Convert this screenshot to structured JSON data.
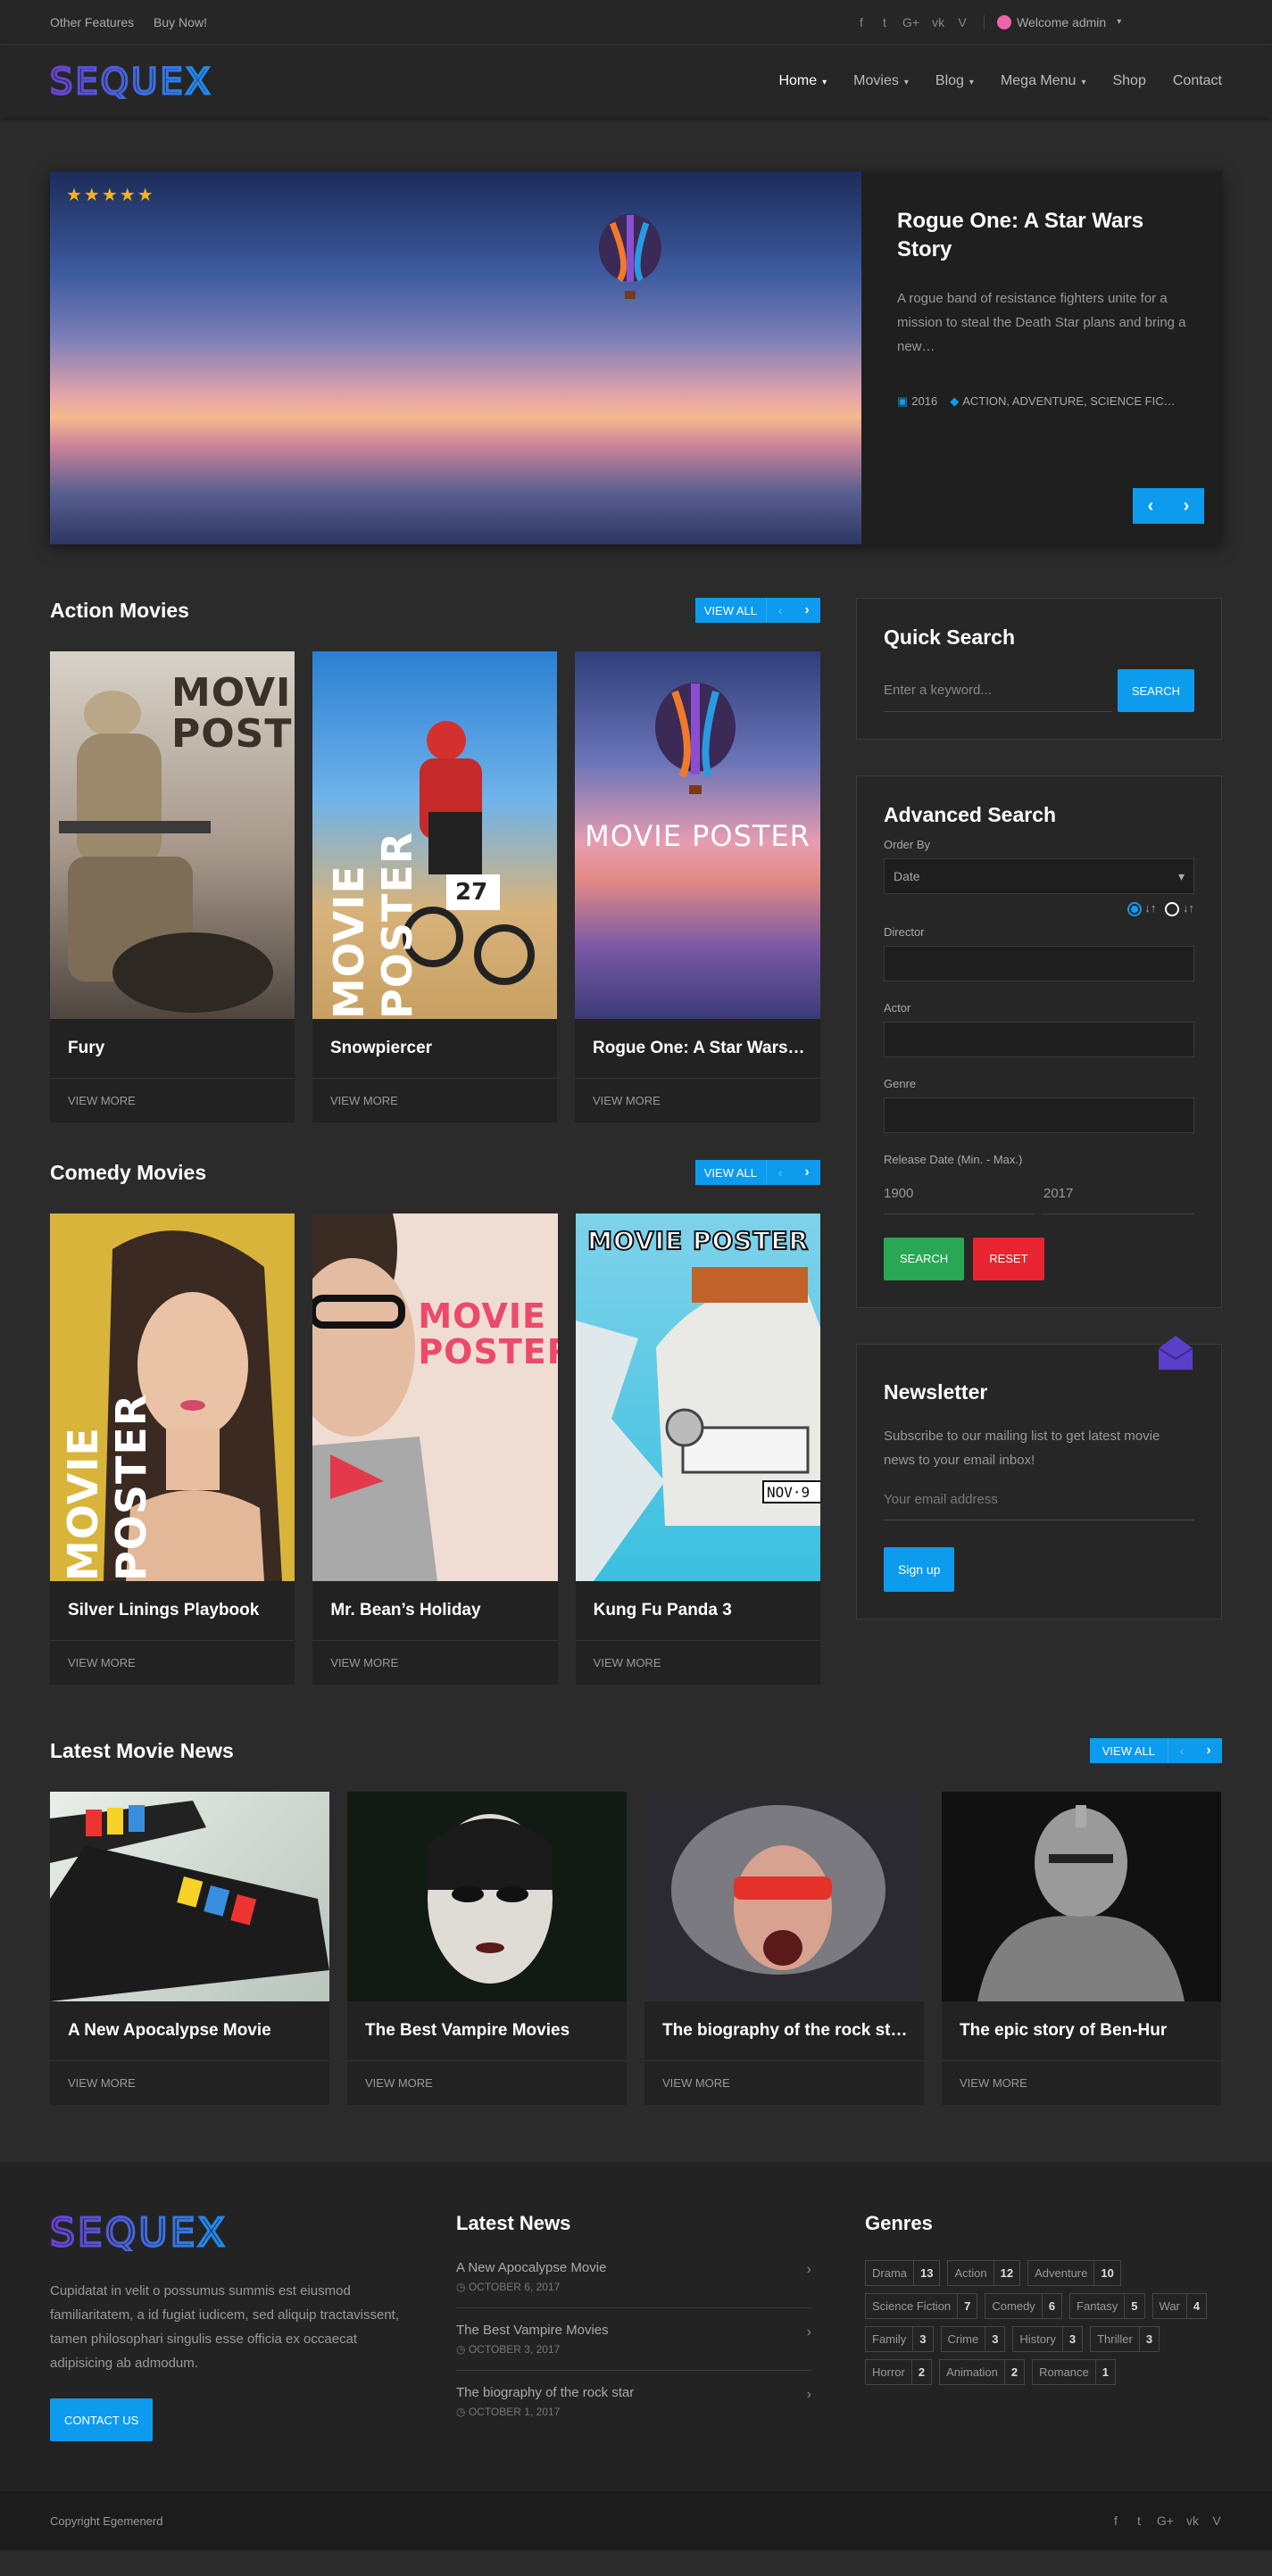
{
  "topbar": {
    "links": [
      "Other Features",
      "Buy Now!"
    ],
    "social": [
      "f",
      "t",
      "G+",
      "vk",
      "V"
    ],
    "welcome": "Welcome admin"
  },
  "nav": {
    "items": [
      {
        "label": "Home",
        "dropdown": true,
        "active": true
      },
      {
        "label": "Movies",
        "dropdown": true
      },
      {
        "label": "Blog",
        "dropdown": true
      },
      {
        "label": "Mega Menu",
        "dropdown": true
      },
      {
        "label": "Shop",
        "dropdown": false
      },
      {
        "label": "Contact",
        "dropdown": false
      }
    ]
  },
  "hero": {
    "rating": "★★★★★",
    "title": "Rogue One: A Star Wars Story",
    "description": "A rogue band of resistance fighters unite for a mission to steal the Death Star plans and bring a new…",
    "year": "2016",
    "genres": "ACTION, ADVENTURE, SCIENCE FIC…"
  },
  "action": {
    "title": "Action Movies",
    "view_all": "VIEW ALL",
    "movies": [
      {
        "title": "Fury",
        "more": "VIEW MORE",
        "poster_text": "MOVIE POSTER"
      },
      {
        "title": "Snowpiercer",
        "more": "VIEW MORE",
        "poster_text": "MOVIE POSTER"
      },
      {
        "title": "Rogue One: A Star Wars…",
        "more": "VIEW MORE",
        "poster_text": "MOVIE POSTER"
      }
    ]
  },
  "comedy": {
    "title": "Comedy Movies",
    "view_all": "VIEW ALL",
    "movies": [
      {
        "title": "Silver Linings Playbook",
        "more": "VIEW MORE",
        "poster_text": "MOVIE POSTER"
      },
      {
        "title": "Mr. Bean’s Holiday",
        "more": "VIEW MORE",
        "poster_text": "MOVIE POSTER"
      },
      {
        "title": "Kung Fu Panda 3",
        "more": "VIEW MORE",
        "poster_text": "MOVIE POSTER"
      }
    ]
  },
  "quick_search": {
    "title": "Quick Search",
    "placeholder": "Enter a keyword...",
    "button": "SEARCH"
  },
  "advanced_search": {
    "title": "Advanced Search",
    "order_by_label": "Order By",
    "order_by_value": "Date",
    "director_label": "Director",
    "actor_label": "Actor",
    "genre_label": "Genre",
    "release_label": "Release Date (Min. - Max.)",
    "date_min": "1900",
    "date_max": "2017",
    "search_button": "SEARCH",
    "reset_button": "RESET"
  },
  "newsletter": {
    "title": "Newsletter",
    "description": "Subscribe to our mailing list to get latest movie news to your email inbox!",
    "placeholder": "Your email address",
    "button": "Sign up"
  },
  "latest_news": {
    "title": "Latest Movie News",
    "view_all": "VIEW ALL",
    "items": [
      {
        "title": "A New Apocalypse Movie",
        "more": "VIEW MORE"
      },
      {
        "title": "The Best Vampire Movies",
        "more": "VIEW MORE"
      },
      {
        "title": "The biography of the rock st…",
        "more": "VIEW MORE"
      },
      {
        "title": "The epic story of Ben-Hur",
        "more": "VIEW MORE"
      }
    ]
  },
  "footer": {
    "about": "Cupidatat in velit o possumus summis est eiusmod familiaritatem, a id fugiat iudicem, sed aliquip tractavissent, tamen philosophari singulis esse officia ex occaecat adipisicing ab admodum.",
    "contact_button": "CONTACT US",
    "news_title": "Latest News",
    "news": [
      {
        "title": "A New Apocalypse Movie",
        "date": "OCTOBER 6, 2017"
      },
      {
        "title": "The Best Vampire Movies",
        "date": "OCTOBER 3, 2017"
      },
      {
        "title": "The biography of the rock star",
        "date": "OCTOBER 1, 2017"
      }
    ],
    "genres_title": "Genres",
    "genres": [
      {
        "name": "Drama",
        "count": "13"
      },
      {
        "name": "Action",
        "count": "12"
      },
      {
        "name": "Adventure",
        "count": "10"
      },
      {
        "name": "Science Fiction",
        "count": "7"
      },
      {
        "name": "Comedy",
        "count": "6"
      },
      {
        "name": "Fantasy",
        "count": "5"
      },
      {
        "name": "War",
        "count": "4"
      },
      {
        "name": "Family",
        "count": "3"
      },
      {
        "name": "Crime",
        "count": "3"
      },
      {
        "name": "History",
        "count": "3"
      },
      {
        "name": "Thriller",
        "count": "3"
      },
      {
        "name": "Horror",
        "count": "2"
      },
      {
        "name": "Animation",
        "count": "2"
      },
      {
        "name": "Romance",
        "count": "1"
      }
    ],
    "copyright": "Copyright Egemenerd"
  },
  "colors": {
    "accent": "#0d9bee",
    "logo": "#5b4fd8",
    "green": "#2aa755",
    "red": "#e82430"
  }
}
